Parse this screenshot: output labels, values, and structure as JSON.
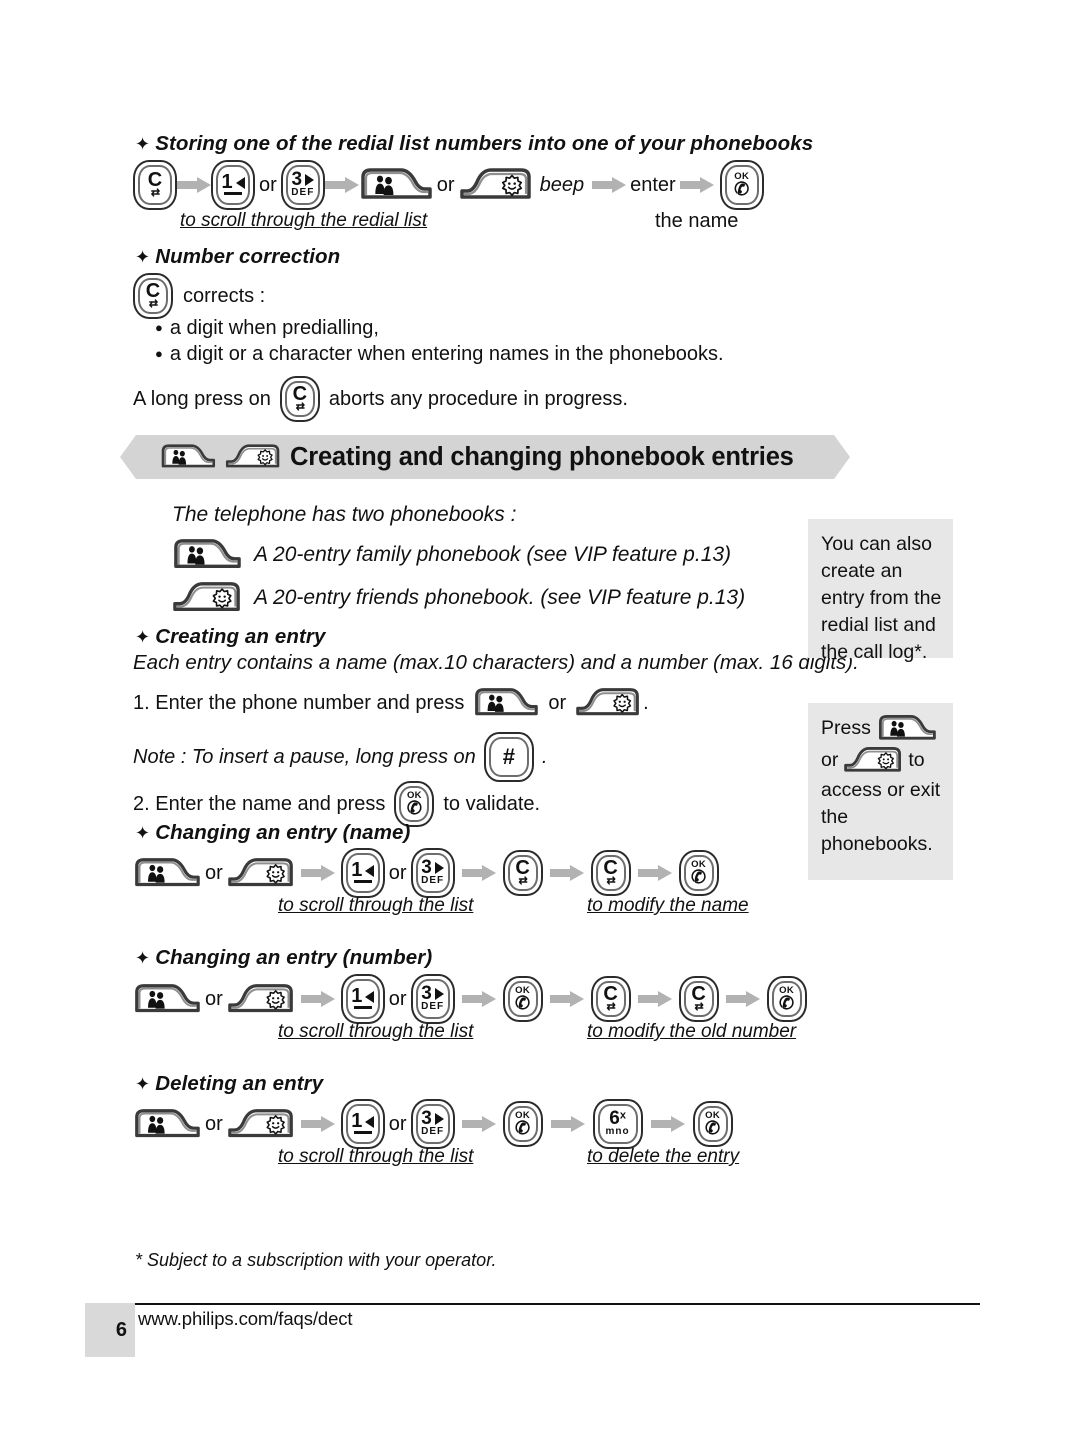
{
  "document": {
    "page_number": "6",
    "footer_url": "www.philips.com/faqs/dect",
    "footnote": "* Subject to a subscription with your operator."
  },
  "section_redial": {
    "heading": "Storing one of the redial list numbers into one of your phonebooks",
    "or_label": "or",
    "beep_label": "beep",
    "enter_label": "enter",
    "caption_scroll": "to scroll through the redial list",
    "caption_name": "the name",
    "keys": [
      "clear-key",
      "key-1-left",
      "key-3-def-right",
      "family-phonebook-key",
      "friends-phonebook-key",
      "ok-key"
    ]
  },
  "section_number_correction": {
    "heading": "Number correction",
    "corrects_label": "corrects :",
    "bullets": [
      "a digit when predialling,",
      "a digit or a character when entering names in the phonebooks."
    ],
    "long_press_before": "A long press on",
    "long_press_after": "aborts any procedure in progress."
  },
  "banner": {
    "title": "Creating and changing phonebook entries",
    "icons": [
      "family-phonebook-key",
      "friends-phonebook-key"
    ]
  },
  "section_phonebooks": {
    "intro": "The telephone has two phonebooks :",
    "items": [
      {
        "icon": "family-phonebook-key",
        "text": "A 20-entry family phonebook (see VIP feature p.13)"
      },
      {
        "icon": "friends-phonebook-key",
        "text": "A 20-entry friends phonebook. (see VIP feature p.13)"
      }
    ]
  },
  "section_creating": {
    "heading": "Creating an entry",
    "intro": "Each entry contains a name (max.10 characters) and a number (max. 16 digits).",
    "step1_before": "1. Enter the phone number and press",
    "step1_or": "or",
    "step1_after": ".",
    "note_before": "Note : To insert a pause, long press on",
    "note_after": ".",
    "step2_before": "2. Enter the name and press",
    "step2_after": "to validate."
  },
  "section_change_name": {
    "heading": "Changing an entry (name)",
    "or_label": "or",
    "caption_scroll": "to scroll through the list",
    "caption_modify": "to modify the name"
  },
  "section_change_number": {
    "heading": "Changing an entry (number)",
    "or_label": "or",
    "caption_scroll": "to scroll through the list",
    "caption_modify": "to modify the old number"
  },
  "section_delete": {
    "heading": "Deleting an entry",
    "or_label": "or",
    "caption_scroll": "to scroll through the list",
    "caption_delete": "to delete the entry"
  },
  "sidebox_1": {
    "text": "You can also create an entry from the redial list and the call log*."
  },
  "sidebox_2": {
    "press_label": "Press",
    "or_label": "or",
    "to_label": "to",
    "tail": "access or exit the phonebooks."
  },
  "keys_glyphs": {
    "clear_letter": "C",
    "clear_arrows": "↔",
    "ok_text": "OK",
    "key1_digit": "1",
    "key3_digit": "3",
    "key3_letters": "DEF",
    "key6_digit": "6",
    "key6_letters": "mno",
    "key6_sup": "x",
    "hash": "#"
  },
  "colors": {
    "banner_bg": "#d4d4d4",
    "sidebox_bg": "#e7e7e7",
    "arrow_gray": "#b0b0b0",
    "key_outline": "#2b2b2b",
    "key_inner": "#6d6d6d"
  }
}
